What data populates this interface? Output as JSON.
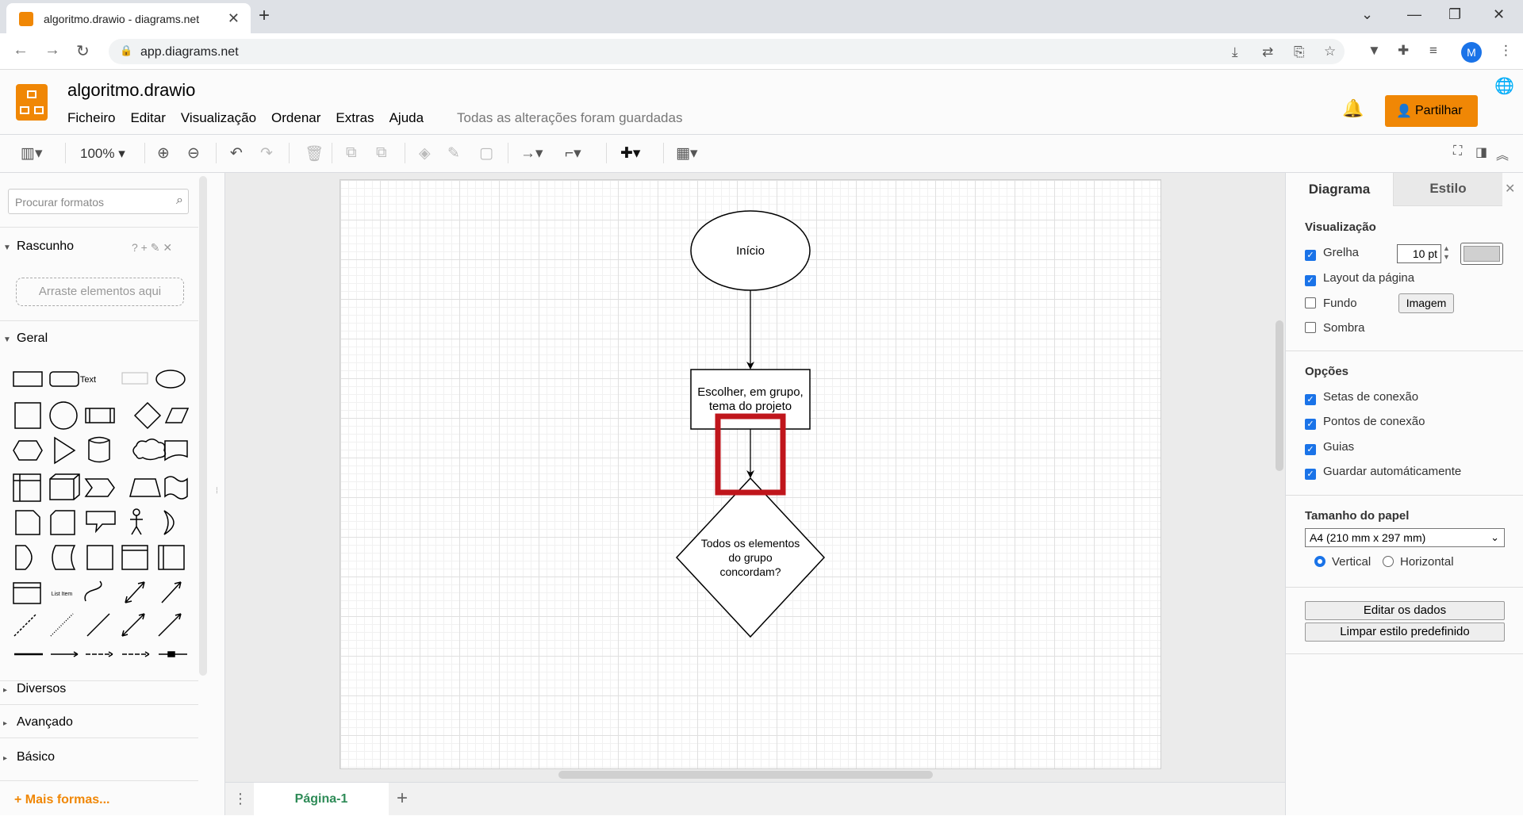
{
  "browser": {
    "tab_title": "algoritmo.drawio - diagrams.net",
    "url": "app.diagrams.net",
    "avatar_letter": "M"
  },
  "app": {
    "filename": "algoritmo.drawio",
    "menus": [
      "Ficheiro",
      "Editar",
      "Visualização",
      "Ordenar",
      "Extras",
      "Ajuda"
    ],
    "save_status": "Todas as alterações foram guardadas",
    "share_label": "Partilhar",
    "accent": "#f08705"
  },
  "toolbar": {
    "zoom": "100%"
  },
  "left": {
    "search_placeholder": "Procurar formatos",
    "scratch_title": "Rascunho",
    "scratch_tools": "? + ✎ ✕",
    "drop_hint": "Arraste elementos aqui",
    "general_title": "Geral",
    "shape_text_label": "Text",
    "shape_list_label": "List Item",
    "sections": [
      "Diversos",
      "Avançado",
      "Básico"
    ],
    "more_shapes": "Mais formas..."
  },
  "diagram": {
    "start_label": "Início",
    "process_line1": "Escolher, em grupo,",
    "process_line2": "tema do projeto",
    "decision_line1": "Todos os elementos",
    "decision_line2": "do grupo",
    "decision_line3": "concordam?",
    "highlight_color": "#c0161c"
  },
  "pages": {
    "current": "Página-1"
  },
  "right": {
    "tab_diagram": "Diagrama",
    "tab_style": "Estilo",
    "view_title": "Visualização",
    "grid_label": "Grelha",
    "grid_size": "10 pt",
    "page_layout_label": "Layout da página",
    "background_label": "Fundo",
    "image_button": "Imagem",
    "shadow_label": "Sombra",
    "options_title": "Opções",
    "connection_arrows": "Setas de conexão",
    "connection_points": "Pontos de conexão",
    "guides": "Guias",
    "autosave": "Guardar automáticamente",
    "paper_title": "Tamanho do papel",
    "paper_size": "A4 (210 mm x 297 mm)",
    "orientation_vertical": "Vertical",
    "orientation_horizontal": "Horizontal",
    "edit_data": "Editar os dados",
    "clear_style": "Limpar estilo predefinido"
  }
}
